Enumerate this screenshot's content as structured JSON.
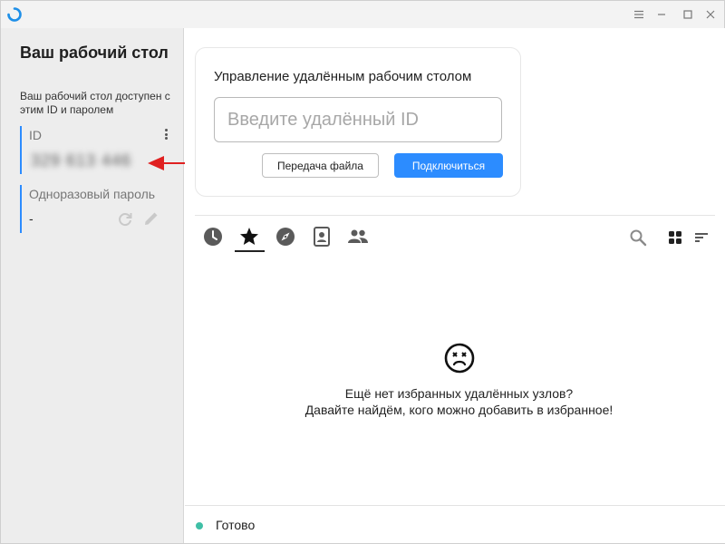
{
  "sidebar": {
    "title": "Ваш рабочий стол",
    "description": "Ваш рабочий стол доступен с этим ID и паролем",
    "id_label": "ID",
    "id_value": "329 613 446",
    "password_label": "Одноразовый пароль",
    "password_value": "-"
  },
  "connect": {
    "title": "Управление удалённым рабочим столом",
    "input_placeholder": "Введите удалённый ID",
    "input_value": "",
    "transfer_label": "Передача файла",
    "connect_label": "Подключиться"
  },
  "tabs": [
    {
      "icon": "history-icon"
    },
    {
      "icon": "star-icon",
      "active": true
    },
    {
      "icon": "compass-icon"
    },
    {
      "icon": "address-book-icon"
    },
    {
      "icon": "group-icon"
    }
  ],
  "empty_state": {
    "line1": "Ещё нет избранных удалённых узлов?",
    "line2": "Давайте найдём, кого можно добавить в избранное!"
  },
  "status": {
    "text": "Готово",
    "color": "#3fbfa6"
  },
  "colors": {
    "accent": "#2c8cff",
    "annotation": "#e02020"
  }
}
